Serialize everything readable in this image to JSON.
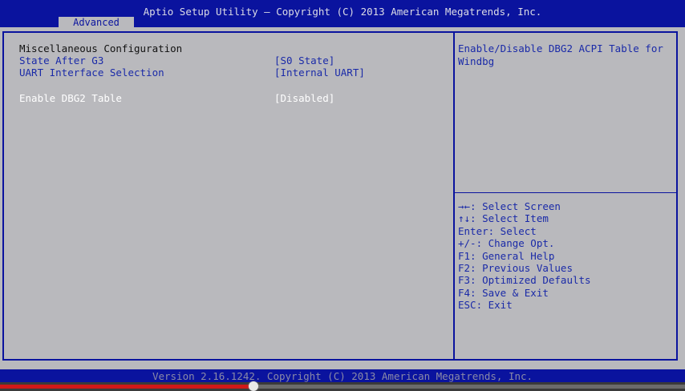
{
  "header": {
    "title": "Aptio Setup Utility – Copyright (C) 2013 American Megatrends, Inc.",
    "active_tab": "Advanced"
  },
  "main": {
    "section_title": "Miscellaneous Configuration",
    "settings": [
      {
        "label": "State After G3",
        "value": "[S0 State]"
      },
      {
        "label": "UART Interface Selection",
        "value": "[Internal UART]"
      },
      {
        "label": "Enable DBG2 Table",
        "value": "[Disabled]"
      }
    ]
  },
  "help": {
    "text": "Enable/Disable DBG2 ACPI Table for Windbg"
  },
  "keys": [
    "→←: Select Screen",
    "↑↓: Select Item",
    "Enter: Select",
    "+/-: Change Opt.",
    "F1: General Help",
    "F2: Previous Values",
    "F3: Optimized Defaults",
    "F4: Save & Exit",
    "ESC: Exit"
  ],
  "footer": {
    "text": "Version 2.16.1242. Copyright (C) 2013 American Megatrends, Inc."
  },
  "video_progress": {
    "played_fraction": 0.37
  },
  "colors": {
    "title_bar": "#0a139e",
    "background": "#b9b9bd",
    "option_text": "#1a2aa8",
    "selected_text": "#ffffff",
    "progress_played": "#d01818"
  }
}
